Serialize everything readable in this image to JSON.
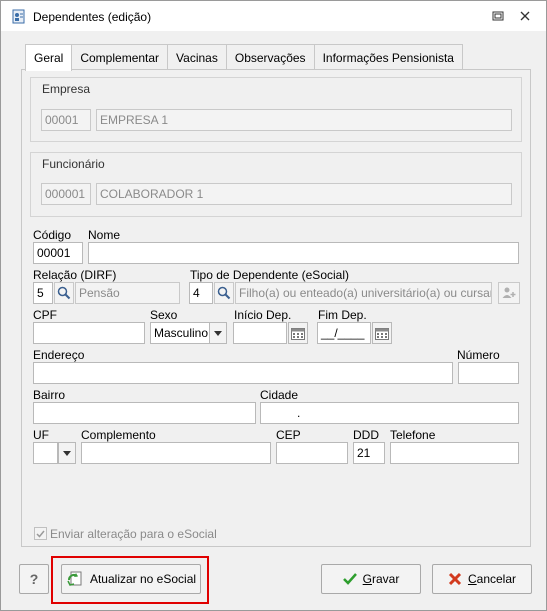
{
  "window": {
    "title": "Dependentes (edição)"
  },
  "tabs": [
    {
      "label": "Geral"
    },
    {
      "label": "Complementar"
    },
    {
      "label": "Vacinas"
    },
    {
      "label": "Observações"
    },
    {
      "label": "Informações Pensionista"
    }
  ],
  "empresa": {
    "group_label": "Empresa",
    "code": "00001",
    "name": "EMPRESA 1"
  },
  "funcionario": {
    "group_label": "Funcionário",
    "code": "000001",
    "name": "COLABORADOR 1"
  },
  "form": {
    "codigo_label": "Código",
    "codigo_value": "00001",
    "nome_label": "Nome",
    "nome_value": "",
    "relacao_label": "Relação (DIRF)",
    "relacao_code": "5",
    "relacao_desc": "Pensão",
    "tipo_label": "Tipo de Dependente (eSocial)",
    "tipo_code": "4",
    "tipo_desc": "Filho(a) ou enteado(a) universitário(a) ou cursando",
    "cpf_label": "CPF",
    "cpf_value": "",
    "sexo_label": "Sexo",
    "sexo_value": "Masculino",
    "inicio_label": "Início Dep.",
    "inicio_value": "",
    "fim_label": "Fim Dep.",
    "fim_value": "__/____",
    "endereco_label": "Endereço",
    "endereco_value": "",
    "numero_label": "Número",
    "numero_value": "",
    "bairro_label": "Bairro",
    "bairro_value": "",
    "cidade_label": "Cidade",
    "cidade_value": ".",
    "uf_label": "UF",
    "uf_value": "",
    "complemento_label": "Complemento",
    "complemento_value": "",
    "cep_label": "CEP",
    "cep_value": "",
    "ddd_label": "DDD",
    "ddd_value": "21",
    "telefone_label": "Telefone",
    "telefone_value": ""
  },
  "esocial_checkbox": {
    "label": "Enviar alteração para o eSocial",
    "checked": true
  },
  "buttons": {
    "help": "?",
    "atualizar": "Atualizar no eSocial",
    "gravar_u": "G",
    "gravar_rest": "ravar",
    "cancelar_u": "C",
    "cancelar_rest": "ancelar"
  },
  "colors": {
    "highlight": "#e00000",
    "check_green": "#2e9e2e",
    "cancel_red": "#d23a1e"
  }
}
